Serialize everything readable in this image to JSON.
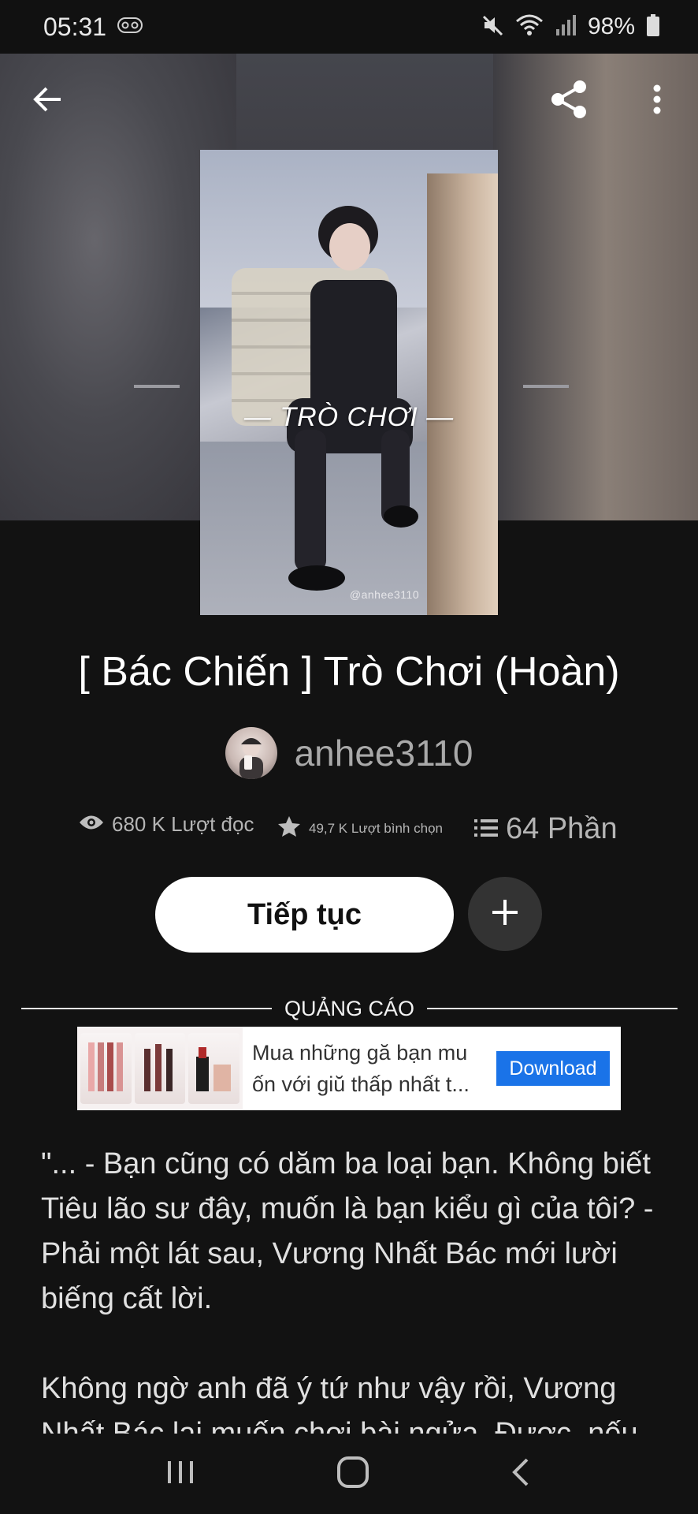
{
  "status_bar": {
    "time": "05:31",
    "battery": "98%",
    "icons": [
      "voicemail-icon",
      "mute-icon",
      "wifi-icon",
      "signal-icon",
      "battery-icon"
    ]
  },
  "top_bar": {
    "icons": [
      "back-arrow-icon",
      "share-icon",
      "more-vertical-icon"
    ]
  },
  "cover": {
    "title_text": "— TRÒ CHƠI —",
    "watermark": "@anhee3110"
  },
  "story": {
    "title": "[ Bác Chiến ] Trò Chơi (Hoàn)",
    "author": "anhee3110"
  },
  "stats": {
    "reads": "680 K Lượt đọc",
    "votes": "49,7 K Lượt bình chọn",
    "parts": "64 Phần"
  },
  "actions": {
    "continue_label": "Tiếp tục",
    "add_label": "+"
  },
  "ad": {
    "label": "QUẢNG CÁO",
    "text": "Mua những gă bạn mu ốn với giŭ thấp nhất t...",
    "button": "Download"
  },
  "description": {
    "paragraph_1": "\"... - Bạn cũng có dăm ba loại bạn. Không biết Tiêu lão sư đây, muốn là bạn kiểu gì của tôi? - Phải một lát sau, Vương Nhất Bác mới lười biếng cất lời.",
    "paragraph_2": "Không ngờ anh đã ý tứ như vậy rồi, Vương Nhất Bác lại muốn chơi bài ngửa. Được, nếu"
  },
  "colors": {
    "background": "#121212",
    "continue_button": "#ffffff",
    "add_button": "#333333",
    "ad_button": "#1a73e8"
  }
}
